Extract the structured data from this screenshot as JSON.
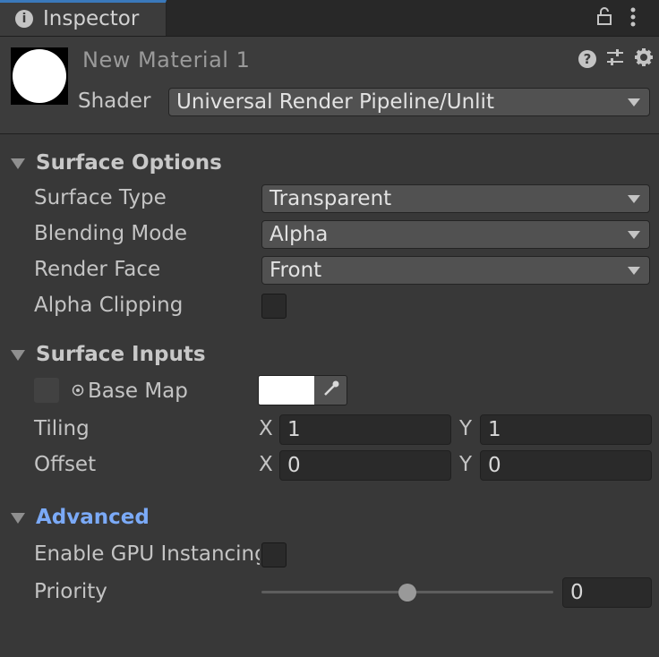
{
  "tab": {
    "title": "Inspector",
    "info_icon": "info-icon",
    "lock_icon": "lock-icon",
    "menu_icon": "more-vertical-icon"
  },
  "header": {
    "material_name": "New Material 1",
    "shader_label": "Shader",
    "shader_value": "Universal Render Pipeline/Unlit",
    "icons": [
      "help-icon",
      "preset-sliders-icon",
      "gear-icon"
    ]
  },
  "surface_options": {
    "title": "Surface Options",
    "surface_type": {
      "label": "Surface Type",
      "value": "Transparent"
    },
    "blending_mode": {
      "label": "Blending Mode",
      "value": "Alpha"
    },
    "render_face": {
      "label": "Render Face",
      "value": "Front"
    },
    "alpha_clipping": {
      "label": "Alpha Clipping",
      "checked": false
    }
  },
  "surface_inputs": {
    "title": "Surface Inputs",
    "base_map": {
      "label": "Base Map",
      "color": "#ffffff"
    },
    "tiling": {
      "label": "Tiling",
      "x_label": "X",
      "x": "1",
      "y_label": "Y",
      "y": "1"
    },
    "offset": {
      "label": "Offset",
      "x_label": "X",
      "x": "0",
      "y_label": "Y",
      "y": "0"
    }
  },
  "advanced": {
    "title": "Advanced",
    "gpu_instancing": {
      "label": "Enable GPU Instancing",
      "checked": false
    },
    "priority": {
      "label": "Priority",
      "value": "0",
      "slider_fraction": 0.5
    }
  },
  "colors": {
    "accent": "#3a79bb",
    "active_section": "#7baaf7"
  }
}
